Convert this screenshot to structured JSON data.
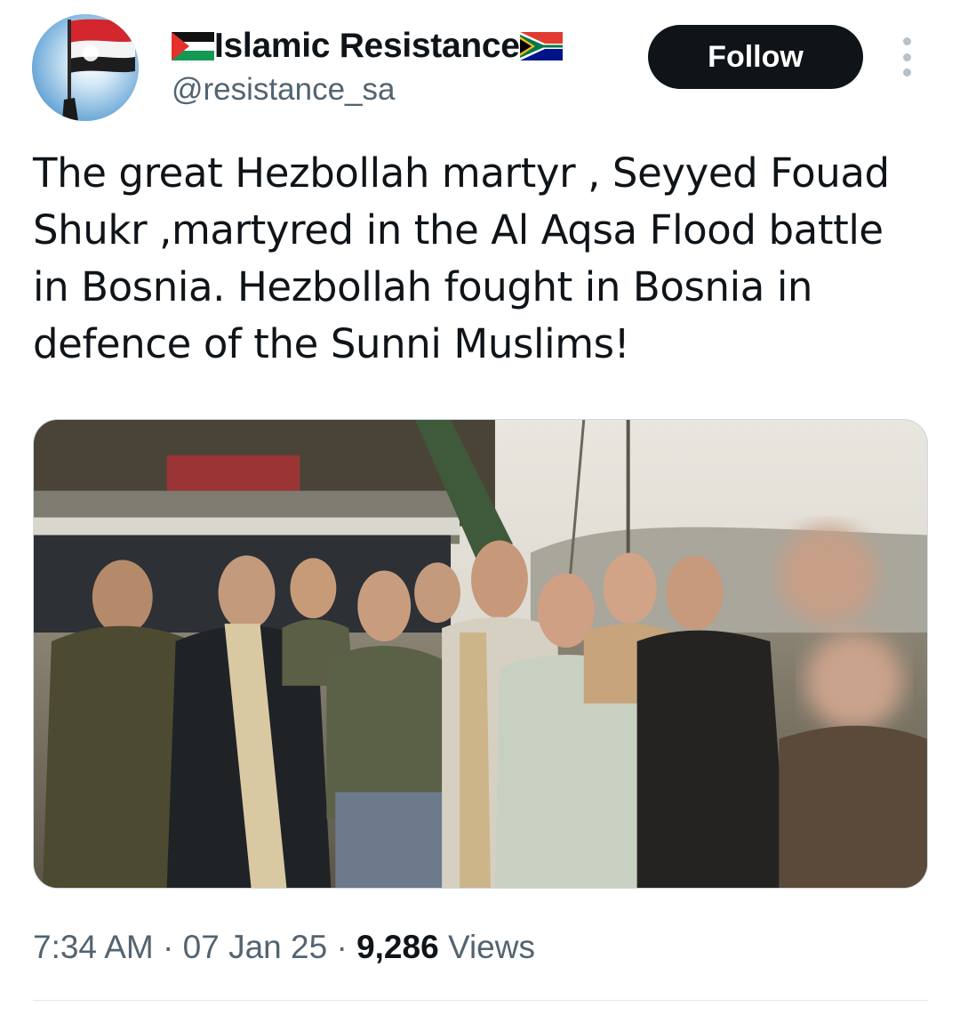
{
  "author": {
    "display_name": "Islamic Resistance",
    "handle": "@resistance_sa",
    "leading_flag_icon": "palestine-flag-icon",
    "trailing_flag_icon": "south-africa-flag-icon",
    "avatar_icon": "profile-avatar-flag-image"
  },
  "actions": {
    "follow_label": "Follow",
    "more_icon": "more-vertical-icon"
  },
  "tweet": {
    "text": "The great Hezbollah martyr , Seyyed Fouad Shukr ,martyred in the Al Aqsa Flood battle in Bosnia. Hezbollah fought in Bosnia in defence of the Sunni Muslims!",
    "media_description_icon": "group-photo-image"
  },
  "meta": {
    "time": "7:34 AM",
    "separator": " · ",
    "date": "07 Jan 25",
    "views_count": "9,286",
    "views_label": " Views"
  },
  "colors": {
    "text_primary": "#0f1419",
    "text_secondary": "#536471",
    "follow_bg": "#0f1419",
    "follow_text": "#ffffff"
  }
}
